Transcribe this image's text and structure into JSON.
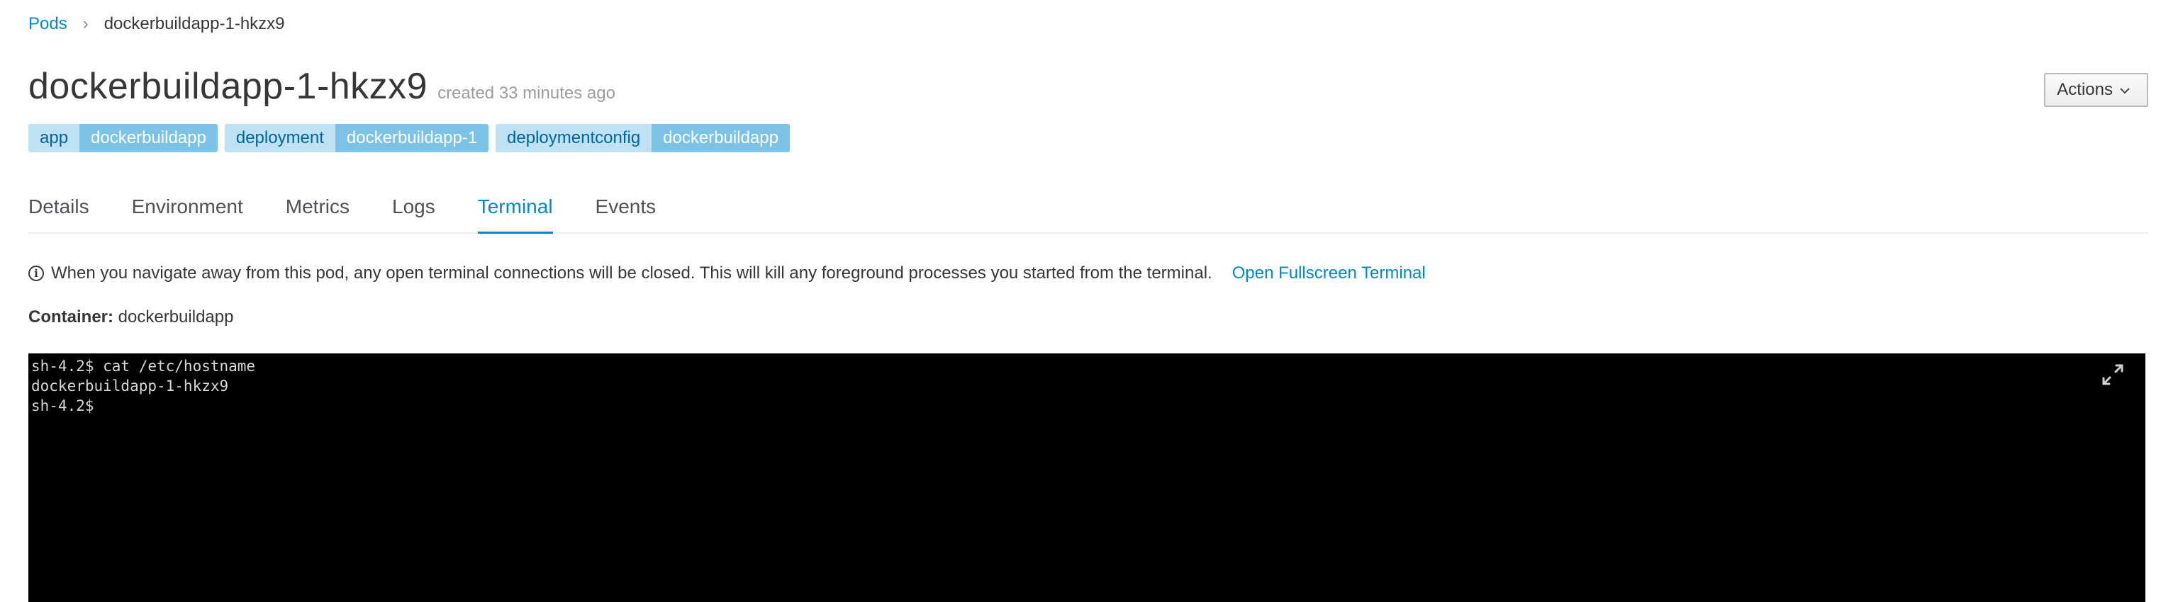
{
  "breadcrumb": {
    "parent_label": "Pods",
    "separator": "›",
    "current_label": "dockerbuildapp-1-hkzx9"
  },
  "header": {
    "title": "dockerbuildapp-1-hkzx9",
    "created_text": "created 33 minutes ago",
    "actions_label": "Actions"
  },
  "labels": [
    {
      "key": "app",
      "value": "dockerbuildapp"
    },
    {
      "key": "deployment",
      "value": "dockerbuildapp-1"
    },
    {
      "key": "deploymentconfig",
      "value": "dockerbuildapp"
    }
  ],
  "tabs": [
    {
      "label": "Details",
      "active": false
    },
    {
      "label": "Environment",
      "active": false
    },
    {
      "label": "Metrics",
      "active": false
    },
    {
      "label": "Logs",
      "active": false
    },
    {
      "label": "Terminal",
      "active": true
    },
    {
      "label": "Events",
      "active": false
    }
  ],
  "notice": {
    "icon": "info-icon",
    "text": "When you navigate away from this pod, any open terminal connections will be closed. This will kill any foreground processes you started from the terminal.",
    "link_label": "Open Fullscreen Terminal"
  },
  "container": {
    "label": "Container:",
    "value": "dockerbuildapp"
  },
  "terminal": {
    "lines": [
      "sh-4.2$ cat /etc/hostname",
      "dockerbuildapp-1-hkzx9",
      "sh-4.2$"
    ],
    "expand_icon": "expand-icon"
  },
  "colors": {
    "link": "#0088ce",
    "label_key_bg": "#bee1f4",
    "label_value_bg": "#7dc3e8",
    "terminal_bg": "#000000"
  }
}
